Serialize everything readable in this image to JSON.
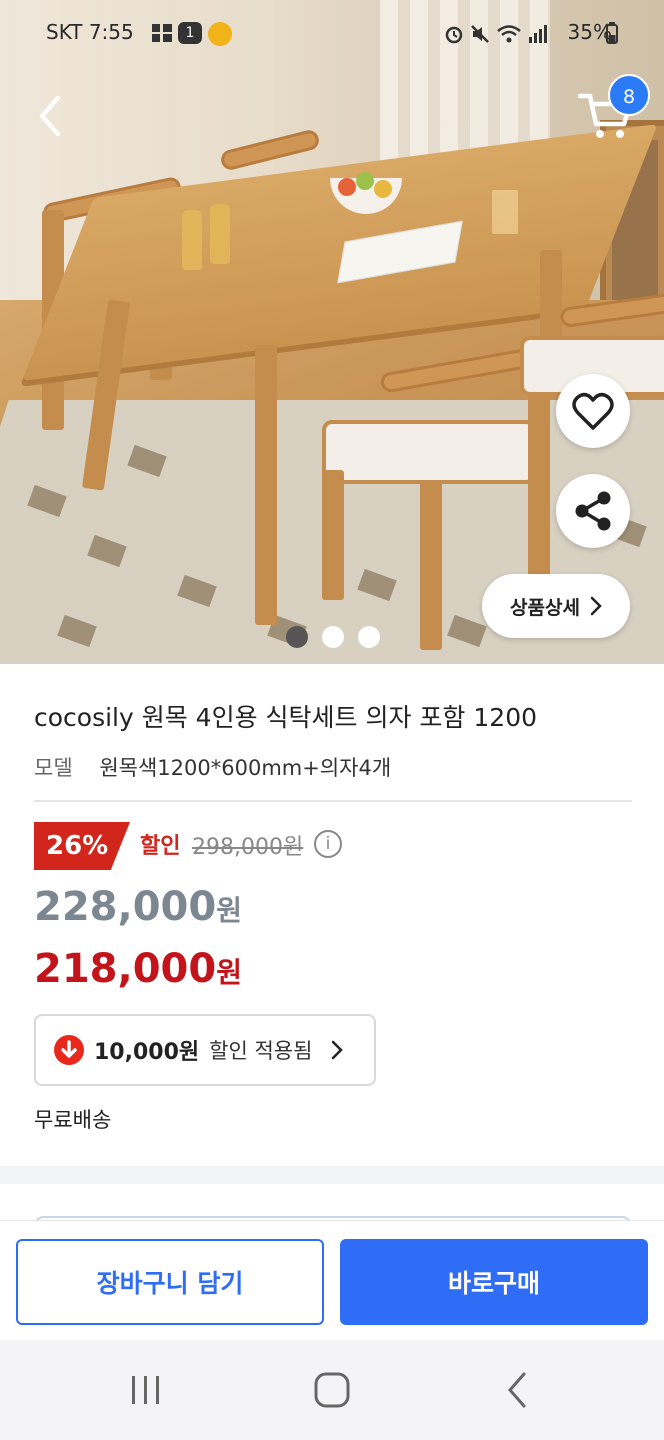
{
  "status_bar": {
    "carrier_time": "SKT 7:55",
    "notification_count": "1",
    "battery": "35%"
  },
  "hero": {
    "cart_count": "8",
    "detail_button_label": "상품상세",
    "pager": {
      "total": 3,
      "active": 1
    }
  },
  "product": {
    "title": "cocosily 원목 4인용 식탁세트 의자 포함 1200",
    "model_label": "모델",
    "model_value": "원목색1200*600mm+의자4개",
    "discount_percent": "26%",
    "discount_label": "할인",
    "original_price": "298,000원",
    "price": "228,000",
    "price_unit": "원",
    "final_price": "218,000",
    "final_price_unit": "원",
    "coupon_amount": "10,000원",
    "coupon_text": "할인 적용됨",
    "shipping": "무료배송"
  },
  "actions": {
    "add_to_cart": "장바구니 담기",
    "buy_now": "바로구매"
  },
  "colors": {
    "accent": "#2f6df6",
    "discount_red": "#d2261c",
    "final_price_red": "#c3141b",
    "cart_badge": "#2b7bf6"
  }
}
